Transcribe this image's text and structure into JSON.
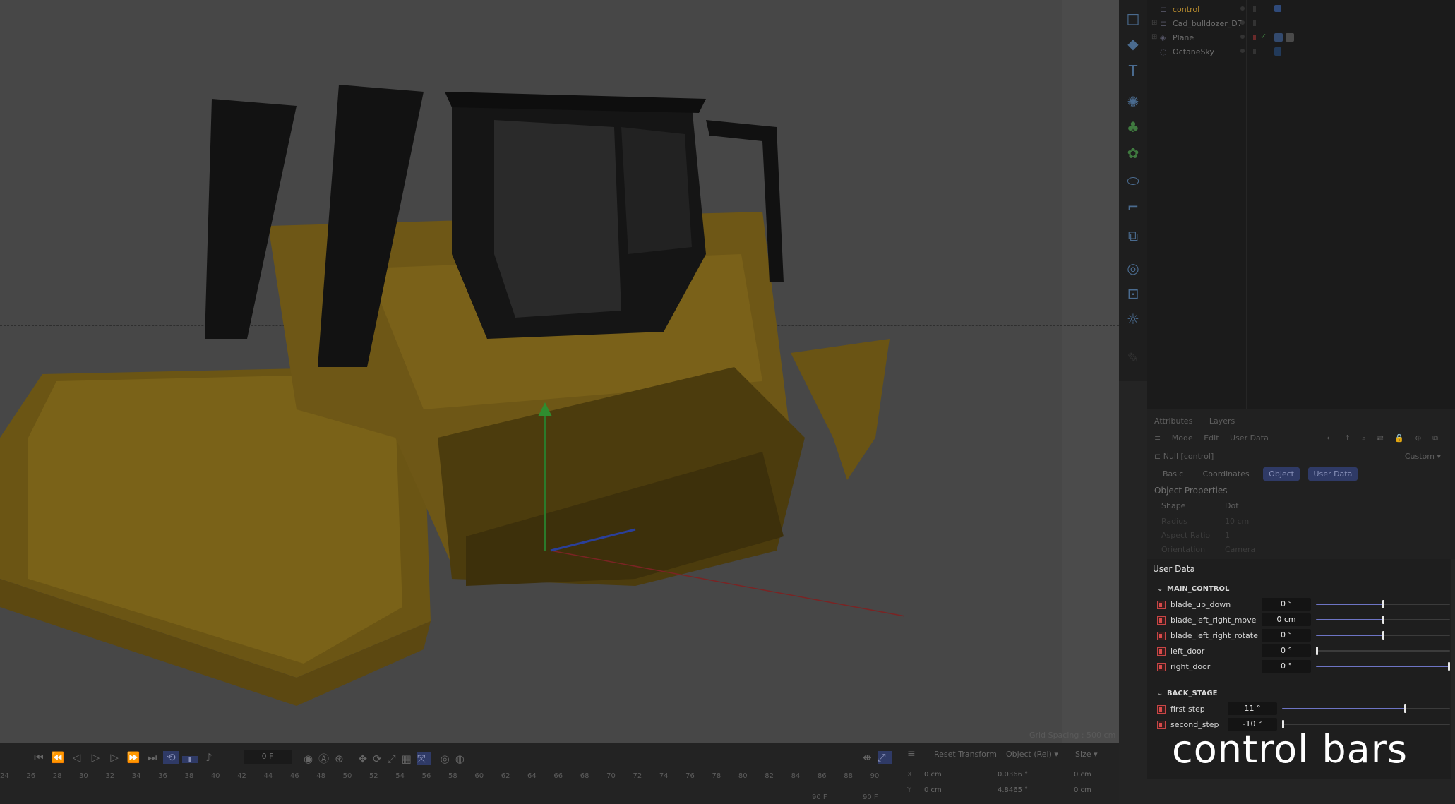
{
  "object_manager": {
    "objects": [
      {
        "name": "control",
        "active": true
      },
      {
        "name": "Cad_bulldozer_D7",
        "active": false
      },
      {
        "name": "Plane",
        "active": false
      },
      {
        "name": "OctaneSky",
        "active": false
      }
    ]
  },
  "attributes": {
    "tabs": [
      "Attributes",
      "Layers"
    ],
    "menu": [
      "Mode",
      "Edit",
      "User Data"
    ],
    "object_title": "Null [control]",
    "preset": "Custom",
    "buttons": [
      "Basic",
      "Coordinates",
      "Object",
      "User Data"
    ],
    "section": "Object Properties",
    "shape_label": "Shape",
    "shape_value": "Dot",
    "radius_label": "Radius",
    "radius_value": "10 cm",
    "aspect_label": "Aspect Ratio",
    "aspect_value": "1",
    "orientation_label": "Orientation",
    "orientation_value": "Camera"
  },
  "user_data": {
    "title": "User Data",
    "groups": [
      {
        "name": "MAIN_CONTROL",
        "params": [
          {
            "label": "blade_up_down",
            "value": "0 °",
            "level": 0.5
          },
          {
            "label": "blade_left_right_move",
            "value": "0 cm",
            "level": 0.5
          },
          {
            "label": "blade_left_right_rotate",
            "value": "0 °",
            "level": 0.5
          },
          {
            "label": "left_door",
            "value": "0 °",
            "level": 0.0
          },
          {
            "label": "right_door",
            "value": "0 °",
            "level": 1.0
          }
        ]
      },
      {
        "name": "BACK_STAGE",
        "params": [
          {
            "label": "first step",
            "value": "11 °",
            "level": 0.73
          },
          {
            "label": "second_step",
            "value": "-10 °",
            "level": 0.0
          }
        ]
      }
    ]
  },
  "caption": "control bars",
  "timeline": {
    "current_frame": "0 F",
    "end_frame_a": "90 F",
    "end_frame_b": "90 F",
    "ruler_ticks": [
      "24",
      "26",
      "28",
      "30",
      "32",
      "34",
      "36",
      "38",
      "40",
      "42",
      "44",
      "46",
      "48",
      "50",
      "52",
      "54",
      "56",
      "58",
      "60",
      "62",
      "64",
      "66",
      "68",
      "70",
      "72",
      "74",
      "76",
      "78",
      "80",
      "82",
      "84",
      "86",
      "88",
      "90"
    ]
  },
  "coordinates": {
    "reset_label": "Reset Transform",
    "mode_label": "Object (Rel)",
    "size_label": "Size",
    "axes": [
      "X",
      "Y"
    ],
    "position": [
      "0 cm",
      "0 cm"
    ],
    "rotation": [
      "0.0366 °",
      "4.8465 °"
    ],
    "size": [
      "0 cm",
      "0 cm"
    ]
  },
  "viewport": {
    "grid_spacing": "Grid Spacing : 500 cm"
  }
}
